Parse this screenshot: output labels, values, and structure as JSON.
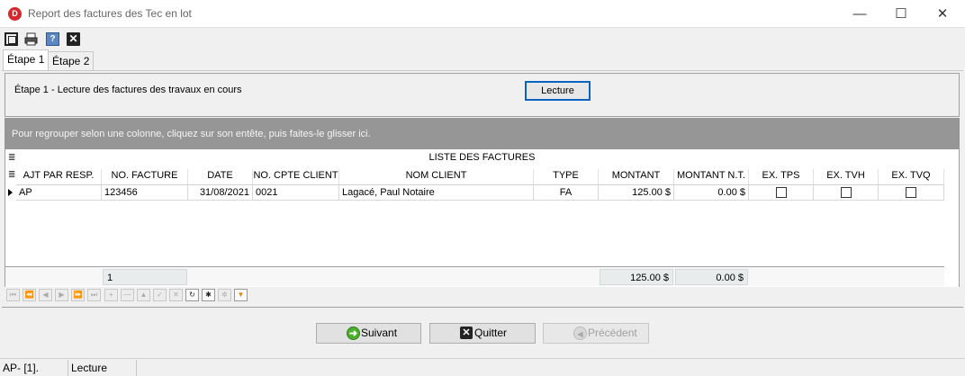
{
  "window": {
    "app_icon_letter": "D",
    "title": "Report des factures des Tec en lot",
    "min_glyph": "—",
    "max_glyph": "☐",
    "close_glyph": "✕"
  },
  "toolbar": {
    "icons": [
      "frame-icon",
      "print-icon",
      "help-icon",
      "close-icon"
    ],
    "help_glyph": "?",
    "close_glyph": "✕"
  },
  "tabs": [
    {
      "label": "Étape 1",
      "active": true
    },
    {
      "label": "Étape 2",
      "active": false
    }
  ],
  "step": {
    "label": "Étape 1  - Lecture des factures des travaux en cours",
    "button_label": "Lecture"
  },
  "group_panel": {
    "text": "Pour regrouper selon une colonne, cliquez sur son entête, puis faites-le glisser ici."
  },
  "grid": {
    "title": "LISTE DES FACTURES",
    "indicator_glyph": "≣",
    "columns": [
      "AJT PAR RESP.",
      "NO. FACTURE",
      "DATE",
      "NO. CPTE CLIENT",
      "NOM CLIENT",
      "TYPE",
      "MONTANT",
      "MONTANT N.T.",
      "EX. TPS",
      "EX. TVH",
      "EX. TVQ"
    ],
    "rows": [
      {
        "ajt_par_resp": "AP",
        "no_facture": "123456",
        "date": "31/08/2021",
        "no_cpte_client": "0021",
        "nom_client": "Lagacé, Paul Notaire",
        "type": "FA",
        "montant": "125.00 $",
        "montant_nt": "0.00 $",
        "ex_tps": false,
        "ex_tvh": false,
        "ex_tvq": false
      }
    ],
    "footer": {
      "count": "1",
      "montant_total": "125.00 $",
      "montant_nt_total": "0.00 $"
    }
  },
  "navigator": {
    "buttons": [
      "first",
      "prev-page",
      "prev",
      "next",
      "next-page",
      "last",
      "append",
      "delete",
      "edit",
      "post",
      "cancel",
      "refresh",
      "bookmark",
      "goto-bookmark",
      "filter"
    ],
    "glyphs": [
      "⏮",
      "⏪",
      "◀",
      "▶",
      "⏩",
      "⏭",
      "+",
      "—",
      "▲",
      "✓",
      "✕",
      "↻",
      "✱",
      "✲",
      "▼"
    ]
  },
  "buttons": {
    "next": {
      "label": "Suivant",
      "icon_glyph": "➜"
    },
    "quit": {
      "label": "Quitter",
      "icon_glyph": "✕"
    },
    "previous": {
      "label": "Précédent",
      "icon_glyph": "◀"
    }
  },
  "status_bar": {
    "cell1": "AP- [1].",
    "cell2": "Lecture"
  }
}
